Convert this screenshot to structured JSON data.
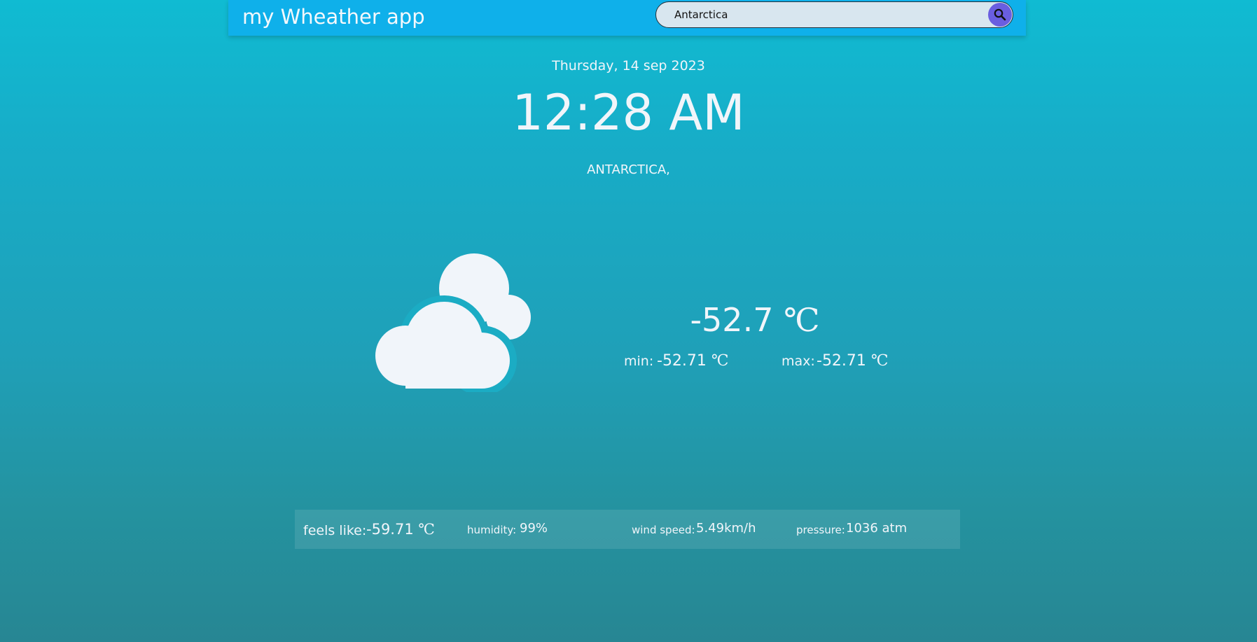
{
  "header": {
    "title": "my Wheather app",
    "search": {
      "value": "Antarctica",
      "button_icon": "search-icon"
    }
  },
  "main": {
    "date": "Thursday, 14 sep 2023",
    "time": "12:28 AM",
    "location": "ANTARCTICA,",
    "weather_icon": "clouds-icon",
    "temperature": "-52.7",
    "unit": "℃",
    "min_label": "min:",
    "min_value": "-52.71",
    "max_label": "max:",
    "max_value": "-52.71"
  },
  "details": {
    "feels_like_label": "feels like:",
    "feels_like_value": "-59.71",
    "humidity_label": "humidity:",
    "humidity_value": "99%",
    "wind_label": "wind speed:",
    "wind_value": "5.49km/h",
    "pressure_label": "pressure:",
    "pressure_value": "1036 atm"
  },
  "colors": {
    "header_bg": "#0fb0ea",
    "search_button": "#6a5ee0",
    "icon_fill": "#f1f5fa"
  }
}
